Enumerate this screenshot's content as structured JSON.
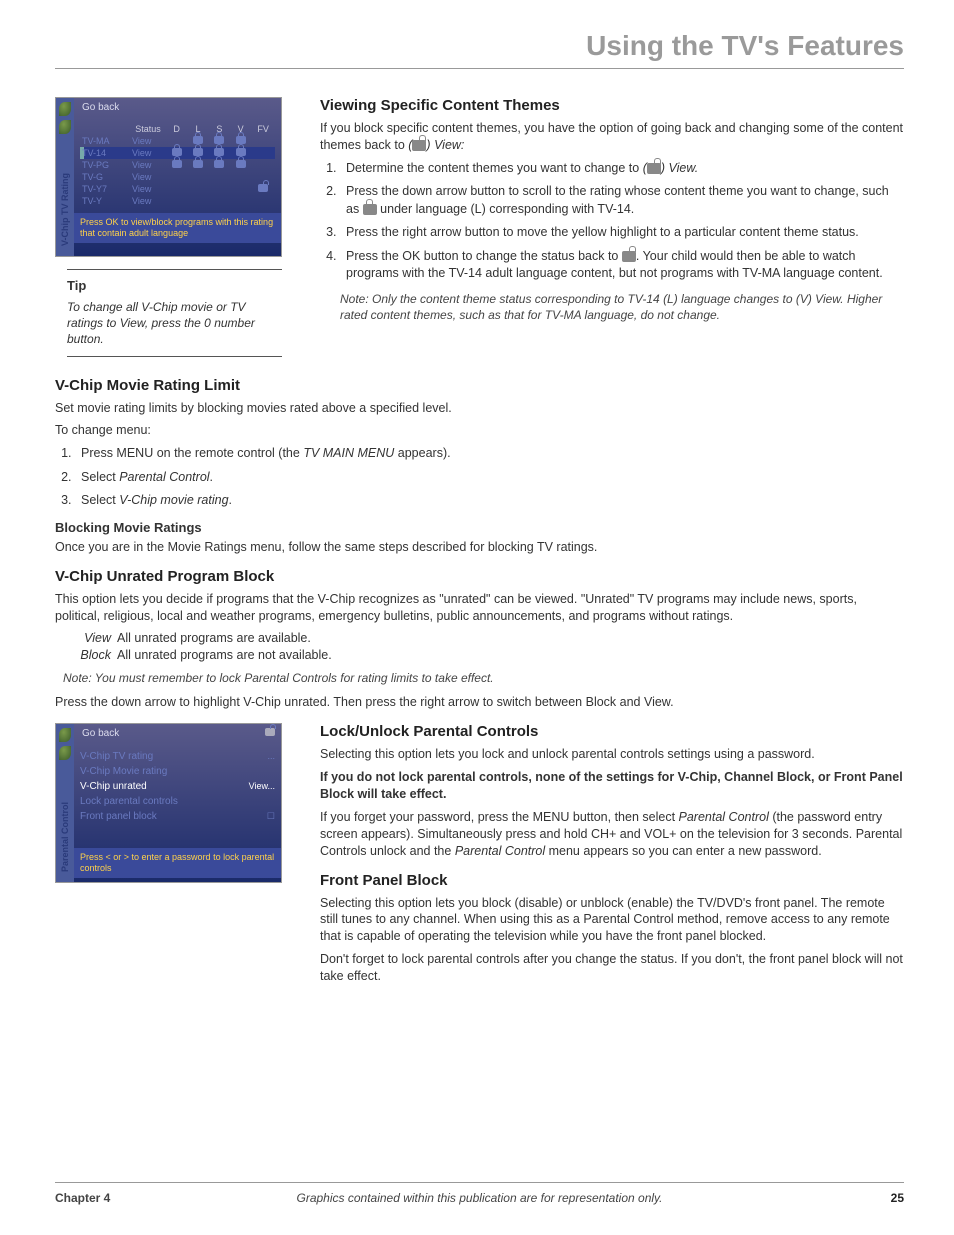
{
  "page": {
    "title": "Using the TV's Features"
  },
  "ss1": {
    "sidebar_label": "V-Chip TV Rating",
    "goback": "Go back",
    "headers": [
      "",
      "Status",
      "D",
      "L",
      "S",
      "V",
      "FV"
    ],
    "rows": [
      {
        "r": "TV-MA",
        "st": "View",
        "cells": [
          "",
          "l",
          "l",
          "l",
          ""
        ]
      },
      {
        "r": "TV-14",
        "st": "View",
        "cells": [
          "l",
          "l",
          "l",
          "l",
          ""
        ],
        "sel": true
      },
      {
        "r": "TV-PG",
        "st": "View",
        "cells": [
          "l",
          "l",
          "l",
          "l",
          ""
        ]
      },
      {
        "r": "TV-G",
        "st": "View",
        "cells": [
          "",
          "",
          "",
          "",
          ""
        ]
      },
      {
        "r": "TV-Y7",
        "st": "View",
        "cells": [
          "",
          "",
          "",
          "",
          "u"
        ]
      },
      {
        "r": "TV-Y",
        "st": "View",
        "cells": [
          "",
          "",
          "",
          "",
          ""
        ]
      }
    ],
    "hint": "Press OK to view/block programs with this rating that contain adult language"
  },
  "ss2": {
    "sidebar_label": "Parental Control",
    "goback": "Go back",
    "rows": [
      {
        "label": "V-Chip TV rating",
        "right": "..."
      },
      {
        "label": "V-Chip Movie rating",
        "right": ""
      },
      {
        "label": "V-Chip unrated",
        "right": "View...",
        "sel": true
      },
      {
        "label": "Lock parental controls",
        "right": ""
      },
      {
        "label": "Front panel block",
        "right": "☐"
      }
    ],
    "hint": "Press < or > to enter a password to lock parental controls"
  },
  "tip": {
    "heading": "Tip",
    "body": "To change all V-Chip movie or TV ratings to View, press the 0 number button."
  },
  "s_themes": {
    "heading": "Viewing Specific Content Themes",
    "intro_a": "If you block specific content themes, you have the option of going back and changing some of the content themes back to ",
    "intro_b": " View:",
    "li1_a": "Determine the content themes you want to change to ",
    "li1_b": " View.",
    "li2_a": "Press the down arrow button to scroll to the rating whose content theme you want to change, such as ",
    "li2_b": " under language (L) corresponding with TV-14.",
    "li3": "Press the right arrow button to move the yellow highlight to a particular content theme status.",
    "li4_a": "Press the OK button to change the status back to ",
    "li4_b": ". Your child would then be able to watch programs with the TV-14 adult language content, but not programs with TV-MA language content.",
    "note": "Note:  Only the content theme status corresponding to TV-14 (L) language changes to (V) View. Higher rated content themes, such as that for TV-MA language, do not change."
  },
  "s_movie": {
    "heading": "V-Chip Movie Rating Limit",
    "p1": "Set movie rating limits by blocking movies rated above a specified level.",
    "p2": "To change menu:",
    "li1_a": "Press MENU on the remote control (the ",
    "li1_it": "TV MAIN MENU",
    "li1_b": " appears).",
    "li2_a": "Select ",
    "li2_it": "Parental Control",
    "li2_b": ".",
    "li3_a": "Select ",
    "li3_it": "V-Chip movie rating",
    "li3_b": ".",
    "sub": "Blocking Movie Ratings",
    "p3": "Once you are in the Movie Ratings menu, follow the same steps described for blocking TV ratings."
  },
  "s_unrated": {
    "heading": "V-Chip Unrated Program Block",
    "p1": "This option lets you decide if programs that the V-Chip recognizes as \"unrated\" can be viewed. \"Unrated\" TV programs may include news, sports, political, religious, local and weather programs, emergency bulletins, public announcements, and programs without ratings.",
    "view_t": "View",
    "view_d": "All unrated programs are available.",
    "block_t": "Block",
    "block_d": "All unrated programs are not available.",
    "note": "Note: You must remember to lock Parental Controls for rating limits to take effect.",
    "p2": "Press the down arrow to highlight V-Chip unrated. Then press the right arrow to switch between Block and View."
  },
  "s_lock": {
    "heading": "Lock/Unlock Parental Controls",
    "p1": "Selecting this option lets you lock and unlock parental controls settings using a password.",
    "p2": "If you do not lock parental controls, none of the settings for V-Chip, Channel Block, or Front Panel Block will take effect.",
    "p3_a": "If you forget your password, press the MENU button, then select ",
    "p3_it": "Parental Control",
    "p3_b": " (the password entry screen appears). Simultaneously press and hold CH+ and VOL+ on the television for 3 seconds. Parental Controls unlock and the ",
    "p3_it2": "Parental Control",
    "p3_c": " menu appears so you can enter a new password."
  },
  "s_front": {
    "heading": "Front Panel Block",
    "p1": "Selecting this option lets you block (disable) or unblock (enable) the TV/DVD's front panel. The remote still tunes to any channel. When using this as a Parental Control method, remove access to any remote that is capable of operating the television while you have the front panel blocked.",
    "p2": "Don't forget to lock parental controls after you change the status. If you don't, the front panel block will not take effect."
  },
  "footer": {
    "chapter": "Chapter 4",
    "center": "Graphics contained within this publication are for representation only.",
    "page": "25"
  }
}
